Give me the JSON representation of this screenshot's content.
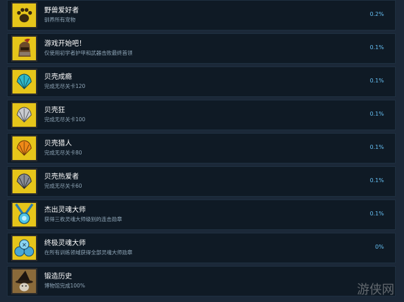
{
  "achievements": [
    {
      "title": "野兽爱好者",
      "desc": "驯养所有宠物",
      "percent": "0.2%",
      "icon": "paw-icon"
    },
    {
      "title": "游戏开始吧！",
      "desc": "仅使用初学者护甲和武器击败最终首领",
      "percent": "0.1%",
      "icon": "knight-helmet-icon"
    },
    {
      "title": "贝壳成瘾",
      "desc": "完成无尽关卡120",
      "percent": "0.1%",
      "icon": "shell-teal-icon"
    },
    {
      "title": "贝壳狂",
      "desc": "完成无尽关卡100",
      "percent": "0.1%",
      "icon": "shell-silver-icon"
    },
    {
      "title": "贝壳猎人",
      "desc": "完成无尽关卡80",
      "percent": "0.1%",
      "icon": "shell-gold-icon"
    },
    {
      "title": "贝壳热爱者",
      "desc": "完成无尽关卡60",
      "percent": "0.1%",
      "icon": "shell-dark-icon"
    },
    {
      "title": "杰出灵魂大师",
      "desc": "获得三枚灵魂大师级别的连击勋章",
      "percent": "0.1%",
      "icon": "soul-medal-icon"
    },
    {
      "title": "终极灵魂大师",
      "desc": "在所有训练领域获得全部灵魂大师勋章",
      "percent": "0%",
      "icon": "ultimate-medals-icon"
    },
    {
      "title": "锻造历史",
      "desc": "博物馆完成100%",
      "percent": "",
      "icon": "wizard-hat-icon"
    }
  ],
  "watermark": "游侠网"
}
